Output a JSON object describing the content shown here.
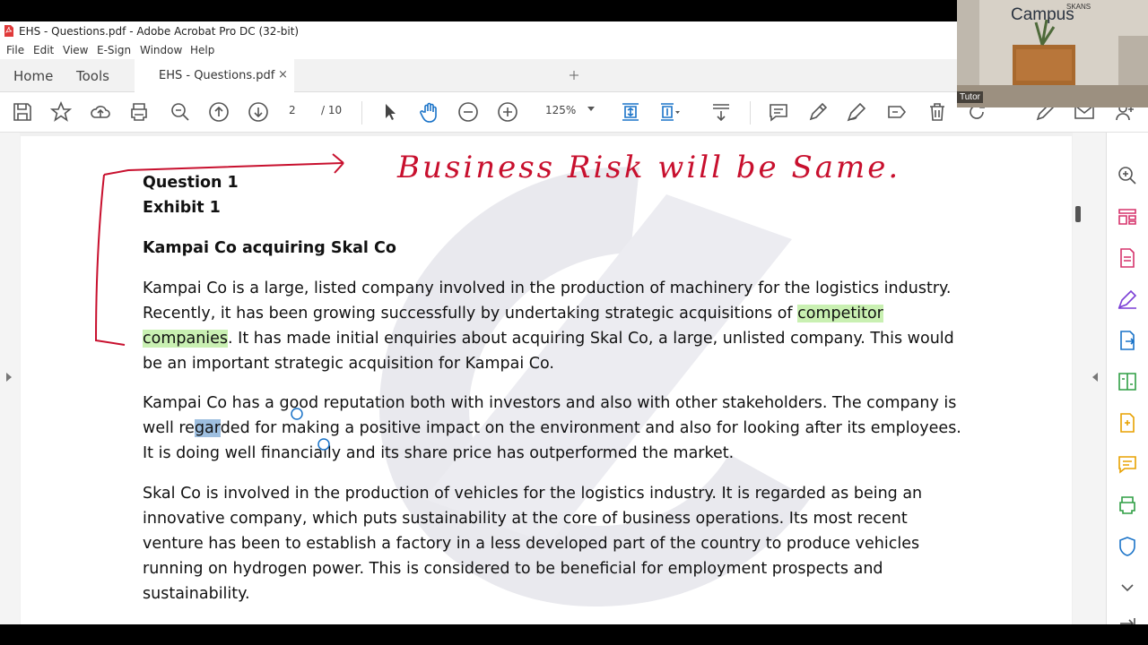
{
  "window": {
    "title": "EHS - Questions.pdf - Adobe Acrobat Pro DC (32-bit)"
  },
  "menu": [
    "File",
    "Edit",
    "View",
    "E-Sign",
    "Window",
    "Help"
  ],
  "tabs": {
    "home": "Home",
    "tools": "Tools",
    "document": "EHS - Questions.pdf",
    "close": "×"
  },
  "toolbar": {
    "page_current": "2",
    "page_total": "/  10",
    "zoom": "125%",
    "icons": [
      "save-icon",
      "bookmark-star-icon",
      "upload-icon",
      "print-icon",
      "search-zoom-icon",
      "page-up-icon",
      "page-down-icon",
      "select-cursor-icon",
      "hand-tool-icon",
      "zoom-out-icon",
      "zoom-in-icon",
      "fit-page-icon",
      "scroll-mode-icon",
      "download-icon",
      "comment-icon",
      "highlight-pen-icon",
      "sign-icon",
      "redact-icon",
      "delete-icon",
      "rotate-icon",
      "edit-sign-icon",
      "email-icon",
      "add-user-icon"
    ]
  },
  "document": {
    "question": "Question 1",
    "exhibit": "Exhibit 1",
    "heading": "Kampai Co acquiring Skal Co",
    "p1_a": "Kampai Co is a large, listed company involved in the production of machinery for the logistics industry. Recently, it has been growing successfully by undertaking strategic acquisitions of ",
    "p1_highlight": "competitor companies",
    "p1_b": ". It has made initial enquiries about acquiring Skal Co, a large, unlisted company. This would be an important strategic acquisition for Kampai Co.",
    "p2_a": "Kampai Co has a good reputation both with investors and also with other stakeholders. The company is well re",
    "p2_sel": "gar",
    "p2_b": "ded for making a positive impact on the environment and also for looking after its employees. It is doing well financially and its share price has outperformed the market.",
    "p3": "Skal Co is involved in the production of vehicles for the logistics industry. It is regarded as being an innovative company, which puts sustainability at the core of business operations. Its most recent venture has been to establish a factory in a less developed part of the country to produce vehicles running on hydrogen power. This is considered to be beneficial for employment prospects and sustainability."
  },
  "annotation": {
    "handwritten": "Business Risk will be Same."
  },
  "webcam": {
    "brand": "Campus",
    "brand_top": "SKANS",
    "label": "Tutor"
  },
  "colors": {
    "ink": "#c8102e",
    "highlight": "#c9f0b2",
    "selection": "#9ebfe0",
    "accent": "#1a73c8"
  }
}
